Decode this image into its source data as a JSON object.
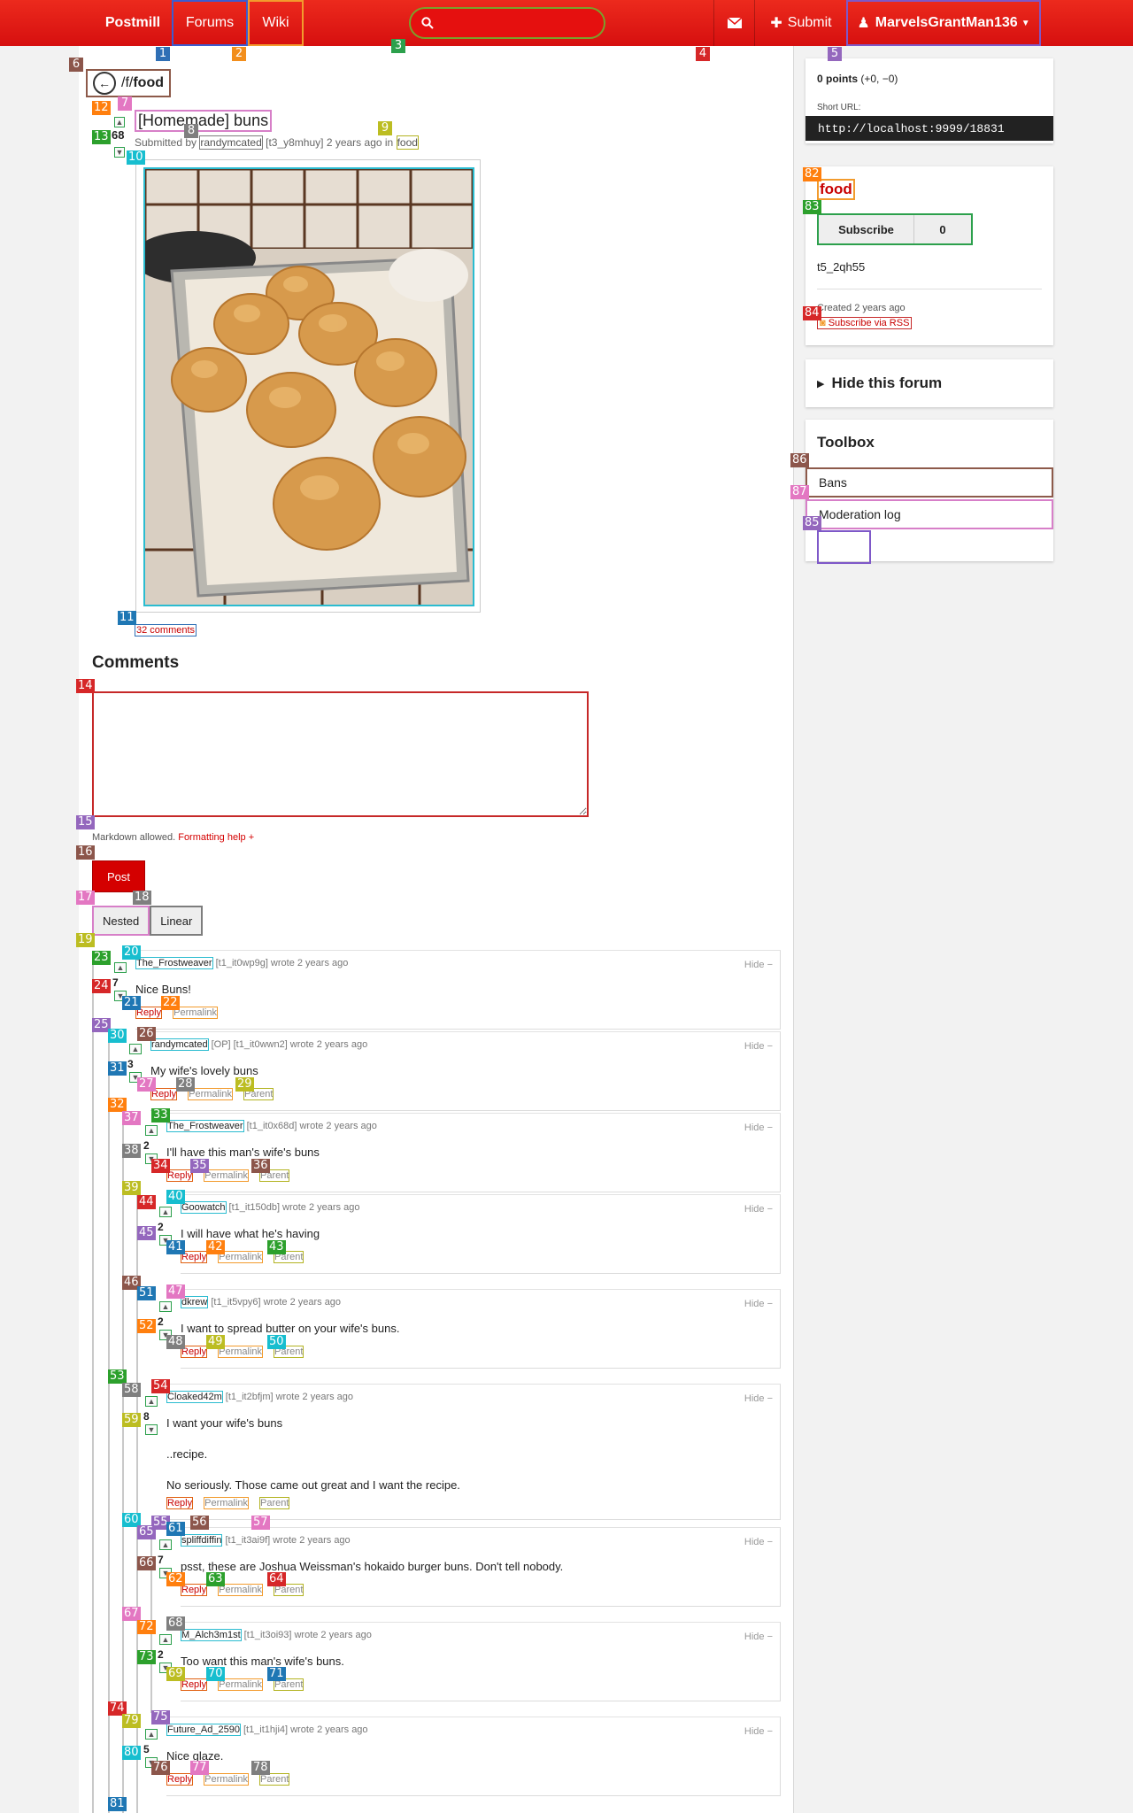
{
  "navbar": {
    "brand": "Postmill",
    "forums": "Forums",
    "wiki": "Wiki",
    "search_icon": "search-icon",
    "mail_icon": "envelope-icon",
    "submit": "Submit",
    "user": "MarvelsGrantMan136",
    "colors": {
      "bar": "#e5100f",
      "forums_outline": "#3c5cd0",
      "wiki_outline": "#f29b2d",
      "search_outline": "#7aa12c"
    }
  },
  "markers": [
    {
      "n": "1",
      "color": "#2f6fb5"
    },
    {
      "n": "2",
      "color": "#f28e1c"
    },
    {
      "n": "3",
      "color": "#2ca04c"
    },
    {
      "n": "4",
      "color": "#d62728"
    },
    {
      "n": "5",
      "color": "#9467bd"
    },
    {
      "n": "6",
      "color": "#8c564b"
    },
    {
      "n": "7",
      "color": "#e377c2"
    },
    {
      "n": "8",
      "color": "#7f7f7f"
    },
    {
      "n": "9",
      "color": "#bcbd22"
    },
    {
      "n": "10",
      "color": "#17becf"
    },
    {
      "n": "11",
      "color": "#1f77b4"
    },
    {
      "n": "12",
      "color": "#ff7f0e"
    },
    {
      "n": "13",
      "color": "#2ca02c"
    },
    {
      "n": "14",
      "color": "#d62728"
    },
    {
      "n": "15",
      "color": "#9467bd"
    },
    {
      "n": "16",
      "color": "#8c564b"
    },
    {
      "n": "17",
      "color": "#e377c2"
    },
    {
      "n": "18",
      "color": "#7f7f7f"
    },
    {
      "n": "19",
      "color": "#bcbd22"
    },
    {
      "n": "20",
      "color": "#17becf"
    },
    {
      "n": "21",
      "color": "#1f77b4"
    },
    {
      "n": "22",
      "color": "#ff7f0e"
    },
    {
      "n": "23",
      "color": "#2ca02c"
    },
    {
      "n": "24",
      "color": "#d62728"
    },
    {
      "n": "25",
      "color": "#9467bd"
    },
    {
      "n": "26",
      "color": "#8c564b"
    },
    {
      "n": "27",
      "color": "#e377c2"
    },
    {
      "n": "28",
      "color": "#7f7f7f"
    },
    {
      "n": "29",
      "color": "#bcbd22"
    },
    {
      "n": "30",
      "color": "#17becf"
    },
    {
      "n": "31",
      "color": "#1f77b4"
    },
    {
      "n": "32",
      "color": "#ff7f0e"
    },
    {
      "n": "33",
      "color": "#2ca02c"
    },
    {
      "n": "34",
      "color": "#d62728"
    },
    {
      "n": "35",
      "color": "#9467bd"
    },
    {
      "n": "36",
      "color": "#8c564b"
    },
    {
      "n": "37",
      "color": "#e377c2"
    },
    {
      "n": "38",
      "color": "#7f7f7f"
    },
    {
      "n": "39",
      "color": "#bcbd22"
    },
    {
      "n": "40",
      "color": "#17becf"
    },
    {
      "n": "41",
      "color": "#1f77b4"
    },
    {
      "n": "42",
      "color": "#ff7f0e"
    },
    {
      "n": "43",
      "color": "#2ca02c"
    },
    {
      "n": "44",
      "color": "#d62728"
    },
    {
      "n": "45",
      "color": "#9467bd"
    },
    {
      "n": "46",
      "color": "#8c564b"
    },
    {
      "n": "47",
      "color": "#e377c2"
    },
    {
      "n": "48",
      "color": "#7f7f7f"
    },
    {
      "n": "49",
      "color": "#bcbd22"
    },
    {
      "n": "50",
      "color": "#17becf"
    },
    {
      "n": "51",
      "color": "#1f77b4"
    },
    {
      "n": "52",
      "color": "#ff7f0e"
    },
    {
      "n": "53",
      "color": "#2ca02c"
    },
    {
      "n": "54",
      "color": "#d62728"
    },
    {
      "n": "55",
      "color": "#9467bd"
    },
    {
      "n": "56",
      "color": "#8c564b"
    },
    {
      "n": "57",
      "color": "#e377c2"
    },
    {
      "n": "58",
      "color": "#7f7f7f"
    },
    {
      "n": "59",
      "color": "#bcbd22"
    },
    {
      "n": "60",
      "color": "#17becf"
    },
    {
      "n": "61",
      "color": "#1f77b4"
    },
    {
      "n": "62",
      "color": "#ff7f0e"
    },
    {
      "n": "63",
      "color": "#2ca02c"
    },
    {
      "n": "64",
      "color": "#d62728"
    },
    {
      "n": "65",
      "color": "#9467bd"
    },
    {
      "n": "66",
      "color": "#8c564b"
    },
    {
      "n": "67",
      "color": "#e377c2"
    },
    {
      "n": "68",
      "color": "#7f7f7f"
    },
    {
      "n": "69",
      "color": "#bcbd22"
    },
    {
      "n": "70",
      "color": "#17becf"
    },
    {
      "n": "71",
      "color": "#1f77b4"
    },
    {
      "n": "72",
      "color": "#ff7f0e"
    },
    {
      "n": "73",
      "color": "#2ca02c"
    },
    {
      "n": "74",
      "color": "#d62728"
    },
    {
      "n": "75",
      "color": "#9467bd"
    },
    {
      "n": "76",
      "color": "#8c564b"
    },
    {
      "n": "77",
      "color": "#e377c2"
    },
    {
      "n": "78",
      "color": "#7f7f7f"
    },
    {
      "n": "79",
      "color": "#bcbd22"
    },
    {
      "n": "80",
      "color": "#17becf"
    },
    {
      "n": "81",
      "color": "#1f77b4"
    },
    {
      "n": "82",
      "color": "#ff7f0e"
    },
    {
      "n": "83",
      "color": "#2ca02c"
    },
    {
      "n": "84",
      "color": "#d62728"
    },
    {
      "n": "85",
      "color": "#9467bd"
    },
    {
      "n": "86",
      "color": "#8c564b"
    },
    {
      "n": "87",
      "color": "#e377c2"
    }
  ],
  "post": {
    "breadcrumb_prefix": "/f/",
    "forum": "food",
    "title": "[Homemade] buns",
    "submitted_by_label": "Submitted by",
    "author": "randymcated",
    "post_id": "[t3_y8mhuy]",
    "time": "2 years ago",
    "in_label": "in",
    "score": "68",
    "comments_link": "32 comments",
    "image_desc": "Tray of baked buns"
  },
  "comment_form": {
    "heading": "Comments",
    "markdown_hint": "Markdown allowed.",
    "formatting_help": "Formatting help +",
    "post_button": "Post",
    "nested": "Nested",
    "linear": "Linear"
  },
  "comments": [
    {
      "author": "The_Frostweaver",
      "op": "",
      "id": "[t1_it0wp9g]",
      "wrote": "wrote 2 years ago",
      "score": "7",
      "body": [
        "Nice Buns!"
      ],
      "actions": [
        "Reply",
        "Permalink"
      ]
    },
    {
      "author": "randymcated",
      "op": "[OP]",
      "id": "[t1_it0wwn2]",
      "wrote": "wrote 2 years ago",
      "score": "3",
      "body": [
        "My wife's lovely buns"
      ],
      "actions": [
        "Reply",
        "Permalink",
        "Parent"
      ]
    },
    {
      "author": "The_Frostweaver",
      "op": "",
      "id": "[t1_it0x68d]",
      "wrote": "wrote 2 years ago",
      "score": "2",
      "body": [
        "I'll have this man's wife's buns"
      ],
      "actions": [
        "Reply",
        "Permalink",
        "Parent"
      ]
    },
    {
      "author": "Goowatch",
      "op": "",
      "id": "[t1_it150db]",
      "wrote": "wrote 2 years ago",
      "score": "2",
      "body": [
        "I will have what he's having"
      ],
      "actions": [
        "Reply",
        "Permalink",
        "Parent"
      ]
    },
    {
      "author": "dkrew",
      "op": "",
      "id": "[t1_it5vpy6]",
      "wrote": "wrote 2 years ago",
      "score": "2",
      "body": [
        "I want to spread butter on your wife's buns."
      ],
      "actions": [
        "Reply",
        "Permalink",
        "Parent"
      ]
    },
    {
      "author": "Cloaked42m",
      "op": "",
      "id": "[t1_it2bfjm]",
      "wrote": "wrote 2 years ago",
      "score": "8",
      "body": [
        "I want your wife's buns",
        "..recipe.",
        "No seriously. Those came out great and I want the recipe."
      ],
      "actions": [
        "Reply",
        "Permalink",
        "Parent"
      ]
    },
    {
      "author": "spliffdiffin",
      "op": "",
      "id": "[t1_it3ai9f]",
      "wrote": "wrote 2 years ago",
      "score": "7",
      "body": [
        "psst, these are Joshua Weissman's hokaido burger buns. Don't tell nobody."
      ],
      "actions": [
        "Reply",
        "Permalink",
        "Parent"
      ]
    },
    {
      "author": "M_Alch3m1st",
      "op": "",
      "id": "[t1_it3oi93]",
      "wrote": "wrote 2 years ago",
      "score": "2",
      "body": [
        "Too want this man's wife's buns."
      ],
      "actions": [
        "Reply",
        "Permalink",
        "Parent"
      ]
    },
    {
      "author": "Future_Ad_2590",
      "op": "",
      "id": "[t1_it1hji4]",
      "wrote": "wrote 2 years ago",
      "score": "5",
      "body": [
        "Nice glaze."
      ],
      "actions": [
        "Reply",
        "Permalink",
        "Parent"
      ]
    }
  ],
  "hide_label": "Hide −",
  "sidebar": {
    "points": "0 points",
    "points_detail": "(+0, −0)",
    "short_url_label": "Short URL:",
    "short_url": "http://localhost:9999/18831",
    "forum_name": "food",
    "subscribe": "Subscribe",
    "subscriber_count": "0",
    "forum_id": "t5_2qh55",
    "created": "Created 2 years ago",
    "rss": "Subscribe via RSS",
    "hide_forum": "Hide this forum",
    "toolbox_title": "Toolbox",
    "bans": "Bans",
    "moderation_log": "Moderation log"
  }
}
